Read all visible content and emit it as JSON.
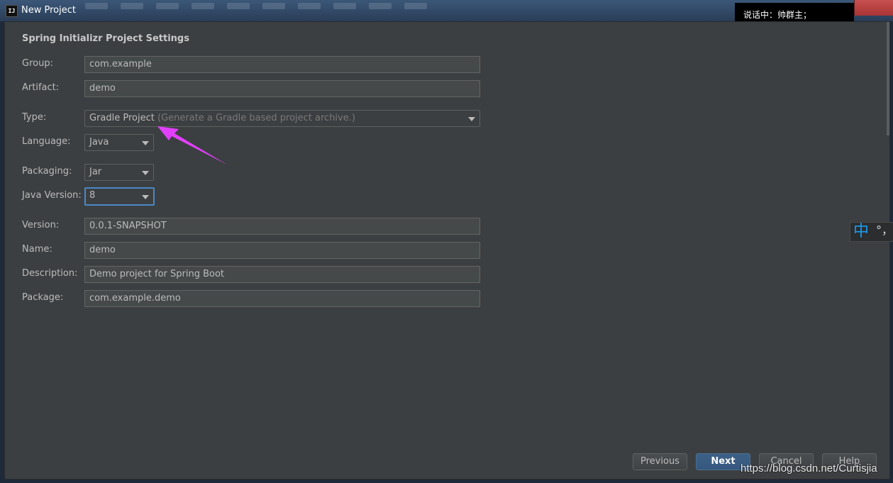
{
  "window": {
    "icon": "intellij-app-icon",
    "icon_text": "IJ",
    "title": "New Project"
  },
  "tooltip": {
    "text": "说话中：帅群主；"
  },
  "form": {
    "section_title": "Spring Initializr Project Settings",
    "group": {
      "label": "Group:",
      "value": "com.example"
    },
    "artifact": {
      "label": "Artifact:",
      "value": "demo"
    },
    "type": {
      "label": "Type:",
      "value": "Gradle Project",
      "hint": "(Generate a Gradle based project archive.)"
    },
    "language": {
      "label": "Language:",
      "value": "Java"
    },
    "packaging": {
      "label": "Packaging:",
      "value": "Jar"
    },
    "java_version": {
      "label": "Java Version:",
      "value": "8"
    },
    "version": {
      "label": "Version:",
      "value": "0.0.1-SNAPSHOT"
    },
    "name": {
      "label": "Name:",
      "value": "demo"
    },
    "description": {
      "label": "Description:",
      "value": "Demo project for Spring Boot"
    },
    "package": {
      "label": "Package:",
      "value": "com.example.demo"
    }
  },
  "buttons": {
    "previous": "Previous",
    "next": "Next",
    "cancel": "Cancel",
    "help": "Help"
  },
  "ime": {
    "mode": "中",
    "punct": "°，"
  },
  "watermark": "https://blog.csdn.net/Curtisjia",
  "colors": {
    "dialog_bg": "#3c3f41",
    "field_bg": "#45494a",
    "focus_border": "#4a88c7",
    "primary_button": "#365880",
    "annotation_arrow": "#e040fb"
  }
}
